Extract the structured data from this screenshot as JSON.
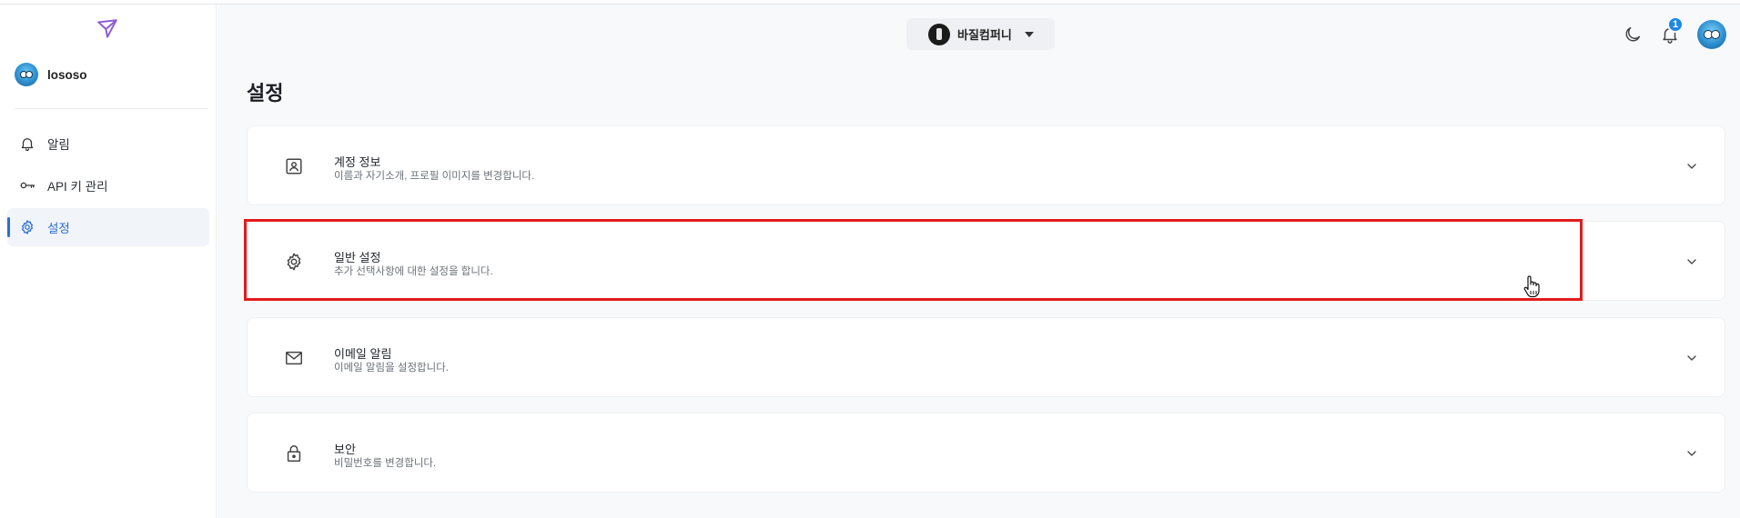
{
  "sidebar": {
    "user_name": "lososo",
    "items": [
      {
        "label": "알림",
        "icon": "bell-icon"
      },
      {
        "label": "API 키 관리",
        "icon": "key-icon"
      },
      {
        "label": "설정",
        "icon": "gear-icon",
        "active": true
      }
    ]
  },
  "header": {
    "org_name": "바질컴퍼니",
    "notification_count": "1"
  },
  "page": {
    "title": "설정"
  },
  "cards": [
    {
      "title": "계정 정보",
      "desc": "이름과 자기소개, 프로필 이미지를 변경합니다.",
      "icon": "id-card-icon"
    },
    {
      "title": "일반 설정",
      "desc": "추가 선택사항에 대한 설정을 합니다.",
      "icon": "gear-icon"
    },
    {
      "title": "이메일 알림",
      "desc": "이메일 알림을 설정합니다.",
      "icon": "mail-icon"
    },
    {
      "title": "보안",
      "desc": "비밀번호를 변경합니다.",
      "icon": "lock-icon"
    }
  ],
  "colors": {
    "accent": "#2b6fd6",
    "highlight": "#e21b1b",
    "badge": "#1e88e5"
  }
}
